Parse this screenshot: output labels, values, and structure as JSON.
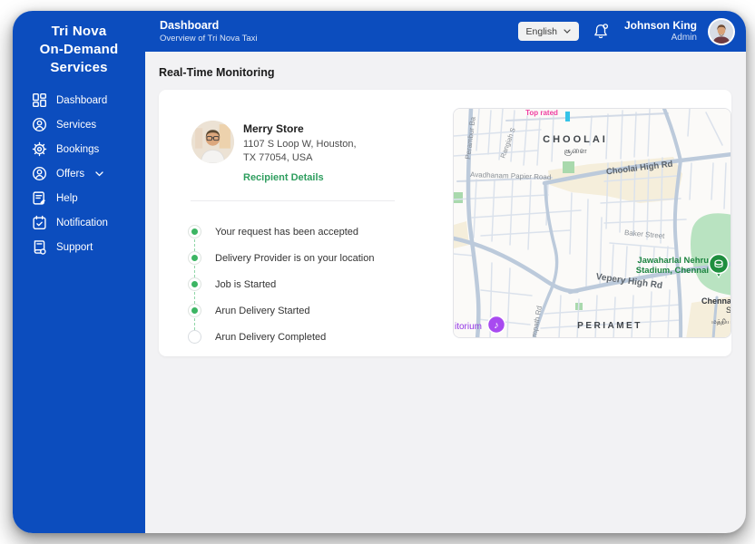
{
  "sidebar": {
    "title_lines": [
      "Tri Nova",
      "On-Demand",
      "Services"
    ],
    "items": [
      {
        "label": "Dashboard",
        "icon": "dashboard-grid-icon"
      },
      {
        "label": "Services",
        "icon": "person-circle-icon"
      },
      {
        "label": "Bookings",
        "icon": "gear-icon"
      },
      {
        "label": "Offers",
        "icon": "person-circle-icon",
        "has_submenu": true
      },
      {
        "label": "Help",
        "icon": "document-pencil-icon"
      },
      {
        "label": "Notification",
        "icon": "calendar-check-icon"
      },
      {
        "label": "Support",
        "icon": "support-book-icon"
      }
    ]
  },
  "header": {
    "title": "Dashboard",
    "subtitle": "Overview of Tri Nova Taxi",
    "language_selector": {
      "value": "English"
    },
    "user": {
      "name": "Johnson King",
      "role": "Admin"
    }
  },
  "main": {
    "section_title": "Real-Time Monitoring",
    "recipient_card": {
      "name": "Merry Store",
      "address_line1": "1107 S Loop W, Houston,",
      "address_line2": "TX 77054, USA",
      "link": "Recipient Details",
      "timeline": [
        {
          "label": "Your request has been accepted",
          "done": true
        },
        {
          "label": "Delivery Provider is on your location",
          "done": true
        },
        {
          "label": "Job is Started",
          "done": true
        },
        {
          "label": "Arun Delivery Started",
          "done": true
        },
        {
          "label": "Arun Delivery Completed",
          "done": false
        }
      ]
    },
    "map": {
      "labels": {
        "top_rated": "Top rated",
        "choolai": "CHOOLAI",
        "choolai_tamil": "சூளை",
        "periamet": "PERIAMET",
        "perambur": "Perambur Ba",
        "rangiah": "Rangiah S",
        "avadhanam": "Avadhanam Papier Road",
        "choolai_high": "Choolai High Rd",
        "baker": "Baker Street",
        "vepery": "Vepery High Rd",
        "mpath": "mpath Rd",
        "stadium_line1": "Jawaharlal Nehru",
        "stadium_line2": "Stadium, Chennai",
        "auditorium": "itorium",
        "chennai1": "Chenna",
        "chennai2": "S",
        "chennai_tamil": "மத்திய"
      },
      "icons": {
        "music_note": "♪"
      }
    }
  },
  "colors": {
    "primary_blue": "#0c4dbe",
    "accent_green": "#3cb563",
    "link_green": "#2f9e5f",
    "map_park_green": "#b9e3c1",
    "map_poi_green": "#1d8440",
    "map_poi_purple": "#a142f4",
    "map_pink": "#f03ea0",
    "content_bg": "#f2f2f4"
  }
}
